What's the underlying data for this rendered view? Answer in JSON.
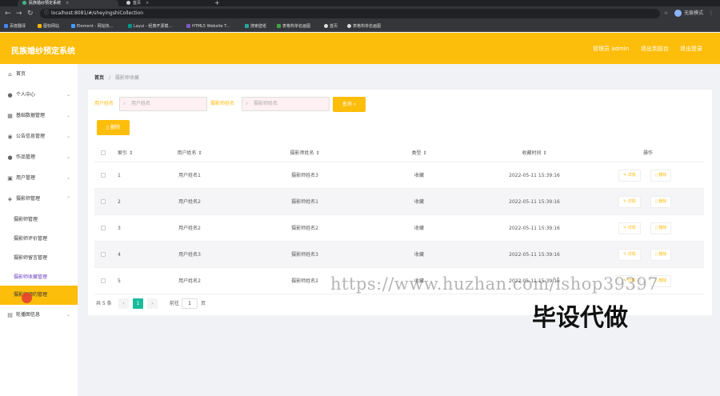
{
  "browser": {
    "tabs": [
      {
        "title": "民族婚纱预定系统",
        "active": true
      },
      {
        "title": "首页",
        "active": false
      }
    ],
    "new_tab": "+",
    "url": "localhost:8081/#/sheyingshiCollection",
    "profile_label": "无痕模式",
    "bookmarks": [
      "百度翻译",
      "图标网站",
      "Element - 网站快...",
      "Layui - 经典开源模...",
      "HTML5 Website T...",
      "搜索壁纸",
      "表格构单名画图",
      "首页",
      "表格构单名画图"
    ]
  },
  "header": {
    "title": "民族婚纱预定系统",
    "user_label": "管理员 admin",
    "exit_front": "退出到前台",
    "logout": "退出登录"
  },
  "sidebar": {
    "items": [
      {
        "label": "首页",
        "icon": "home-icon"
      },
      {
        "label": "个人中心",
        "icon": "user-icon"
      },
      {
        "label": "基础数据管理",
        "icon": "grid-icon"
      },
      {
        "label": "公告信息管理",
        "icon": "bell-icon"
      },
      {
        "label": "作品管理",
        "icon": "picture-icon"
      },
      {
        "label": "用户管理",
        "icon": "users-icon"
      },
      {
        "label": "摄影师管理",
        "icon": "camera-icon"
      }
    ],
    "sub_items": [
      "摄影师管理",
      "摄影师评价管理",
      "摄影师留言管理",
      "摄影师收藏管理",
      "摄影师预约管理"
    ],
    "last_item": {
      "label": "轮播图信息",
      "icon": "image-icon"
    }
  },
  "breadcrumb": {
    "home": "首页",
    "separator": "/",
    "current": "摄影师收藏"
  },
  "search": {
    "user_label": "用户姓名",
    "user_placeholder": "用户姓名",
    "photographer_label": "摄影师姓名",
    "photographer_placeholder": "摄影师姓名",
    "query_button": "查询"
  },
  "delete_button": "删除",
  "table": {
    "columns": [
      "索引",
      "用户姓名",
      "摄影师姓名",
      "类型",
      "收藏时间",
      "操作"
    ],
    "sort_mark": "⇕",
    "detail_label": "详情",
    "delete_label": "删除",
    "rows": [
      {
        "index": "1",
        "user": "用户姓名1",
        "photographer": "摄影师姓名3",
        "type": "收藏",
        "time": "2022-05-11 15:39:16"
      },
      {
        "index": "2",
        "user": "用户姓名2",
        "photographer": "摄影师姓名1",
        "type": "收藏",
        "time": "2022-05-11 15:39:16"
      },
      {
        "index": "3",
        "user": "用户姓名2",
        "photographer": "摄影师姓名2",
        "type": "收藏",
        "time": "2022-05-11 15:39:16"
      },
      {
        "index": "4",
        "user": "用户姓名3",
        "photographer": "摄影师姓名3",
        "type": "收藏",
        "time": "2022-05-11 15:39:16"
      },
      {
        "index": "5",
        "user": "用户姓名2",
        "photographer": "摄影师姓名2",
        "type": "收藏",
        "time": "2022-05-11 15:39:16"
      }
    ]
  },
  "pagination": {
    "total": "共 5 条",
    "prev": "‹",
    "current": "1",
    "next": "›",
    "goto": "前往",
    "page_input": "1",
    "page_unit": "页"
  },
  "watermark": "https://www.huzhan.com/ishop39397",
  "overlay_text": "毕设代做",
  "colors": {
    "accent": "#fdbd0b",
    "page_active": "#1abc9c",
    "hover_purple": "#6b3fbf"
  }
}
